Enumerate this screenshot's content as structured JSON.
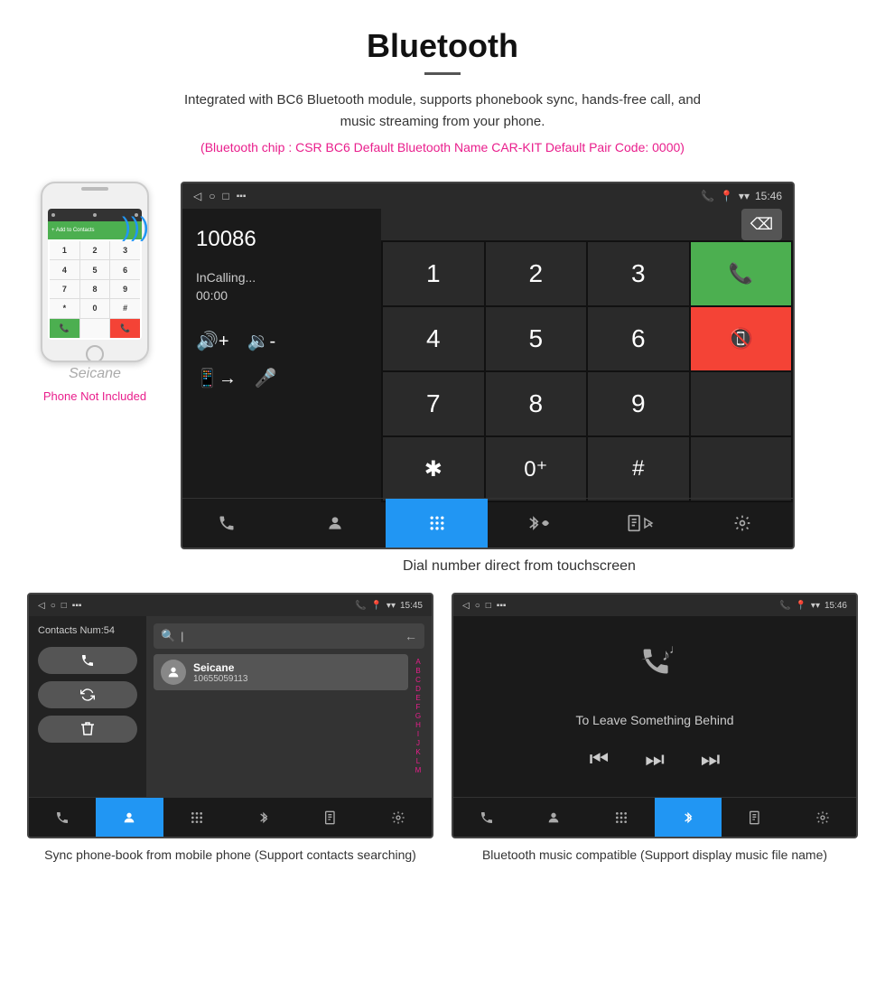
{
  "header": {
    "title": "Bluetooth",
    "description": "Integrated with BC6 Bluetooth module, supports phonebook sync, hands-free call, and music streaming from your phone.",
    "specs": "(Bluetooth chip : CSR BC6    Default Bluetooth Name CAR-KIT    Default Pair Code: 0000)"
  },
  "phone_label": "Phone Not Included",
  "seicane_watermark": "Seicane",
  "dialer": {
    "number": "10086",
    "status": "InCalling...",
    "timer": "00:00",
    "time": "15:46"
  },
  "caption_main": "Dial number direct from touchscreen",
  "phonebook": {
    "contacts_num": "Contacts Num:54",
    "contact_name": "Seicane",
    "contact_number": "10655059113",
    "time": "15:45",
    "alphabet": [
      "A",
      "B",
      "C",
      "D",
      "E",
      "F",
      "G",
      "H",
      "I",
      "J",
      "K",
      "L",
      "M"
    ]
  },
  "music": {
    "song_title": "To Leave Something Behind",
    "time": "15:46"
  },
  "caption_phonebook": "Sync phone-book from mobile phone\n(Support contacts searching)",
  "caption_music": "Bluetooth music compatible\n(Support display music file name)",
  "nav_items": [
    "📞",
    "👤",
    "⋮⋮⋮",
    "🔵",
    "📱",
    "⚙"
  ],
  "keypad": {
    "keys": [
      "1",
      "2",
      "3",
      "4",
      "5",
      "6",
      "7",
      "8",
      "9",
      "0+",
      "#",
      "*"
    ]
  }
}
